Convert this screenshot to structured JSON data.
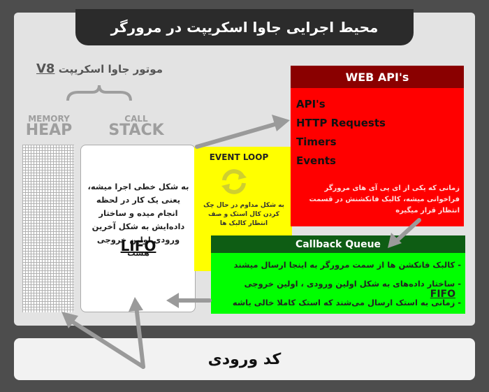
{
  "title": "محیط اجرایی جاوا اسکریپت در مرورگر",
  "engine": {
    "label": "موتور جاوا اسکریپت",
    "name": "V8"
  },
  "memory_heap": {
    "small": "MEMORY",
    "big": "HEAP"
  },
  "call_stack": {
    "small": "CALL",
    "big": "STACK",
    "description": "به شکل خطی اجرا میشه، یعنی یک کار در لحظه انجام میده و ساختار داده‌ایش به شکل آخرین ورودی اولین خروجی هست",
    "acronym": "LIFO"
  },
  "event_loop": {
    "label": "EVENT LOOP",
    "description": "به شکل مداوم در حال چک کردن کال استک و صف انتظار کالبک ها"
  },
  "web_apis": {
    "title": "WEB API's",
    "items": [
      "API's",
      "HTTP Requests",
      "Timers",
      "Events"
    ],
    "description": "زمانی که یکی از ای پی آی های مرورگر فراخوانی میشه، کالبک فانکشنش در قسمت انتظار قرار میگیره"
  },
  "callback_queue": {
    "title": "Callback Queue",
    "item1": "- کالبک فانکشن ها از سمت مرورگر به اینجا ارسال میشند",
    "item2_text": "- ساختار داده‌های به شکل اولین ورودی ، اولین خروجی",
    "item2_acronym": "FIFO",
    "item3": "- زمانی به استک ارسال می‌شند که استک کاملا خالی باشه"
  },
  "input_code": {
    "label": "کد ورودی"
  },
  "colors": {
    "title_bar": "#2b2b2b",
    "web_api_header": "#8a0000",
    "web_api_panel": "#ff0000",
    "event_loop_panel": "#ffff00",
    "callback_header": "#0e5d14",
    "callback_panel": "#00ff00",
    "arrows": "#9a9a9a"
  },
  "icons": {
    "event_loop": "refresh-cycle-icon"
  }
}
